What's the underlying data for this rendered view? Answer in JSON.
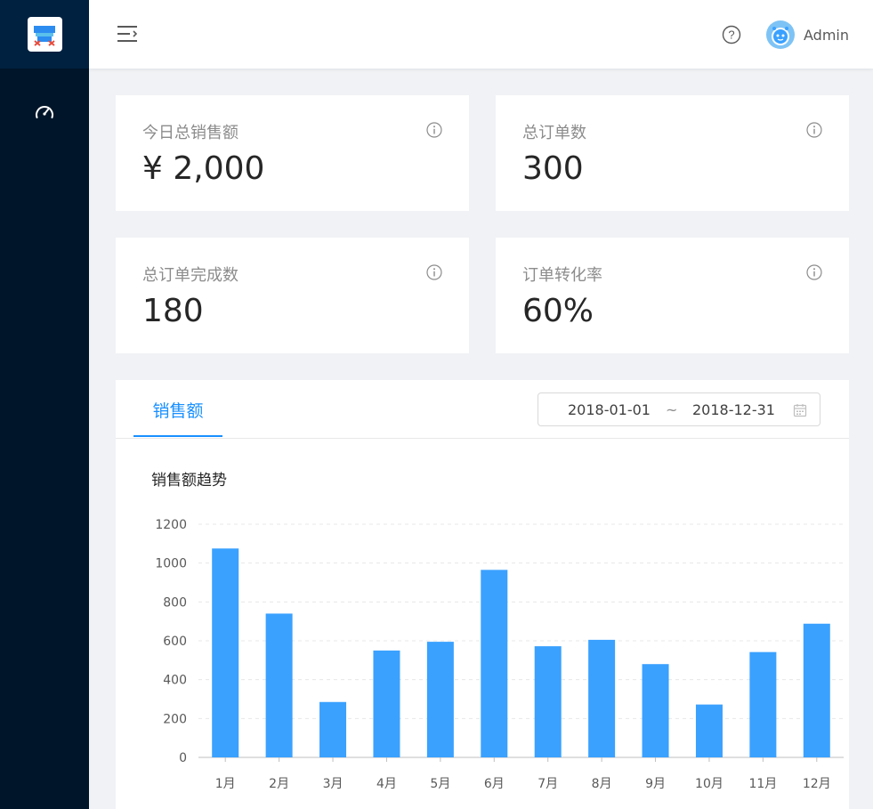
{
  "header": {
    "username": "Admin"
  },
  "sidebar": {
    "items": [
      {
        "icon": "dashboard-icon"
      }
    ]
  },
  "cards": [
    {
      "label": "今日总销售额",
      "value": "¥ 2,000"
    },
    {
      "label": "总订单数",
      "value": "300"
    },
    {
      "label": "总订单完成数",
      "value": "180"
    },
    {
      "label": "订单转化率",
      "value": "60%"
    }
  ],
  "sales": {
    "tab_label": "销售额",
    "range_start": "2018-01-01",
    "range_separator": "~",
    "range_end": "2018-12-31"
  },
  "chart_data": {
    "type": "bar",
    "title": "销售额趋势",
    "categories": [
      "1月",
      "2月",
      "3月",
      "4月",
      "5月",
      "6月",
      "7月",
      "8月",
      "9月",
      "10月",
      "11月",
      "12月"
    ],
    "values": [
      1075,
      740,
      285,
      550,
      595,
      965,
      572,
      605,
      480,
      272,
      542,
      688
    ],
    "ylim": [
      0,
      1200
    ],
    "yticks": [
      0,
      200,
      400,
      600,
      800,
      1000,
      1200
    ],
    "bar_color": "#3aa1ff",
    "grid": true
  },
  "colors": {
    "sider": "#001529",
    "accent": "#1890ff"
  }
}
